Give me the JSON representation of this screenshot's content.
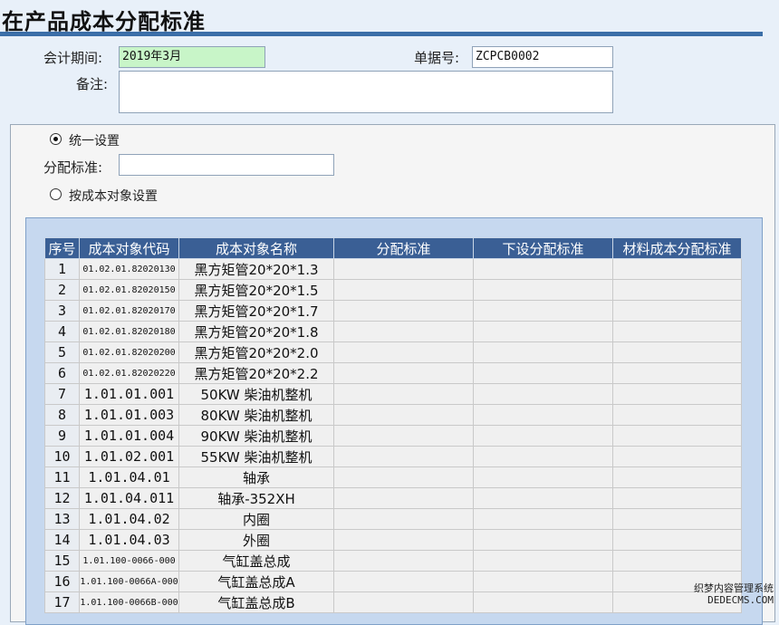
{
  "page": {
    "title": "在产品成本分配标准"
  },
  "form": {
    "period_label": "会计期间:",
    "period_value": "2019年3月",
    "docno_label": "单据号:",
    "docno_value": "ZCPCB0002",
    "remark_label": "备注:",
    "remark_value": ""
  },
  "options": {
    "unified_label": "统一设置",
    "unified_selected": true,
    "standard_label": "分配标准:",
    "standard_value": "",
    "by_object_label": "按成本对象设置",
    "by_object_selected": false
  },
  "table": {
    "columns": [
      "序号",
      "成本对象代码",
      "成本对象名称",
      "分配标准",
      "下设分配标准",
      "材料成本分配标准"
    ],
    "rows": [
      {
        "no": "1",
        "code": "01.02.01.82020130",
        "name": "黑方矩管20*20*1.3",
        "std": "",
        "sub": "",
        "mat": ""
      },
      {
        "no": "2",
        "code": "01.02.01.82020150",
        "name": "黑方矩管20*20*1.5",
        "std": "",
        "sub": "",
        "mat": ""
      },
      {
        "no": "3",
        "code": "01.02.01.82020170",
        "name": "黑方矩管20*20*1.7",
        "std": "",
        "sub": "",
        "mat": ""
      },
      {
        "no": "4",
        "code": "01.02.01.82020180",
        "name": "黑方矩管20*20*1.8",
        "std": "",
        "sub": "",
        "mat": ""
      },
      {
        "no": "5",
        "code": "01.02.01.82020200",
        "name": "黑方矩管20*20*2.0",
        "std": "",
        "sub": "",
        "mat": ""
      },
      {
        "no": "6",
        "code": "01.02.01.82020220",
        "name": "黑方矩管20*20*2.2",
        "std": "",
        "sub": "",
        "mat": ""
      },
      {
        "no": "7",
        "code": "1.01.01.001",
        "name": "50KW 柴油机整机",
        "std": "",
        "sub": "",
        "mat": ""
      },
      {
        "no": "8",
        "code": "1.01.01.003",
        "name": "80KW 柴油机整机",
        "std": "",
        "sub": "",
        "mat": ""
      },
      {
        "no": "9",
        "code": "1.01.01.004",
        "name": "90KW 柴油机整机",
        "std": "",
        "sub": "",
        "mat": ""
      },
      {
        "no": "10",
        "code": "1.01.02.001",
        "name": "55KW 柴油机整机",
        "std": "",
        "sub": "",
        "mat": ""
      },
      {
        "no": "11",
        "code": "1.01.04.01",
        "name": "轴承",
        "std": "",
        "sub": "",
        "mat": ""
      },
      {
        "no": "12",
        "code": "1.01.04.011",
        "name": "轴承-352XH",
        "std": "",
        "sub": "",
        "mat": ""
      },
      {
        "no": "13",
        "code": "1.01.04.02",
        "name": "内圈",
        "std": "",
        "sub": "",
        "mat": ""
      },
      {
        "no": "14",
        "code": "1.01.04.03",
        "name": "外圈",
        "std": "",
        "sub": "",
        "mat": ""
      },
      {
        "no": "15",
        "code": "1.01.100-0066-000",
        "name": "气缸盖总成",
        "std": "",
        "sub": "",
        "mat": ""
      },
      {
        "no": "16",
        "code": "1.01.100-0066A-000",
        "name": "气缸盖总成A",
        "std": "",
        "sub": "",
        "mat": ""
      },
      {
        "no": "17",
        "code": "1.01.100-0066B-000",
        "name": "气缸盖总成B",
        "std": "",
        "sub": "",
        "mat": ""
      }
    ]
  },
  "watermark": {
    "line1": "织梦内容管理系统",
    "line2": "DEDECMS.COM"
  }
}
